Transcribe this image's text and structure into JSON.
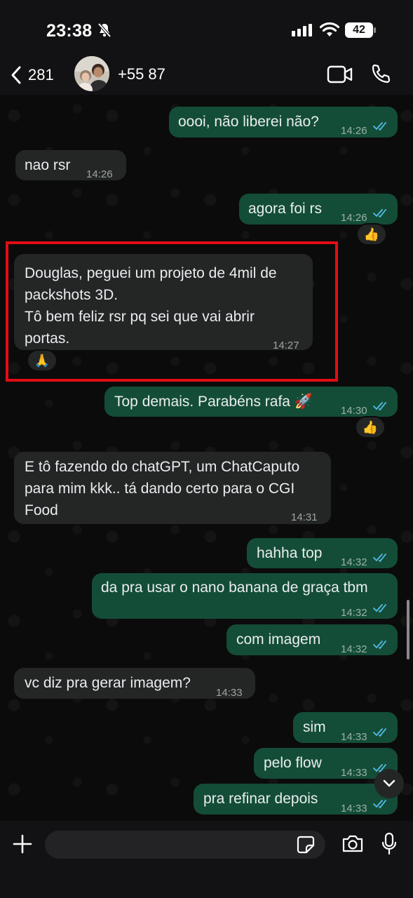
{
  "status_bar": {
    "time": "23:38",
    "battery": "42",
    "icons": [
      "bell-slash-icon",
      "signal-icon",
      "wifi-icon",
      "battery-icon"
    ]
  },
  "header": {
    "back_count": "281",
    "contact": "+55 87",
    "icons": [
      "chevron-left-icon",
      "video-call-icon",
      "phone-icon"
    ]
  },
  "messages": [
    {
      "dir": "out",
      "text": "oooi, não liberei não?",
      "time": "14:26",
      "read": true
    },
    {
      "dir": "in",
      "text": "nao rsr",
      "time": "14:26"
    },
    {
      "dir": "out",
      "text": "agora foi rs",
      "time": "14:26",
      "read": true,
      "reaction": "👍"
    },
    {
      "dir": "in",
      "text": "Douglas, peguei um projeto de 4mil de\npackshots 3D.\nTô bem feliz rsr pq sei que vai abrir\nportas.",
      "time": "14:27",
      "reaction": "🙏",
      "highlighted": true
    },
    {
      "dir": "out",
      "text": "Top demais. Parabéns rafa 🚀",
      "time": "14:30",
      "read": true,
      "reaction": "👍"
    },
    {
      "dir": "in",
      "text": "E tô fazendo do chatGPT, um ChatCaputo\npara mim kkk.. tá dando certo para o CGI\nFood",
      "time": "14:31"
    },
    {
      "dir": "out",
      "text": "hahha top",
      "time": "14:32",
      "read": true
    },
    {
      "dir": "out",
      "text": "da pra usar o nano banana de graça tbm",
      "time": "14:32",
      "read": true
    },
    {
      "dir": "out",
      "text": "com imagem",
      "time": "14:32",
      "read": true
    },
    {
      "dir": "in",
      "text": "vc diz pra gerar imagem?",
      "time": "14:33"
    },
    {
      "dir": "out",
      "text": "sim",
      "time": "14:33",
      "read": true
    },
    {
      "dir": "out",
      "text": "pelo flow",
      "time": "14:33",
      "read": true
    },
    {
      "dir": "out",
      "text": "pra refinar depois",
      "time": "14:33",
      "read": true
    }
  ],
  "input": {
    "placeholder": "",
    "icons": [
      "plus-icon",
      "sticker-icon",
      "camera-icon",
      "microphone-icon"
    ]
  },
  "colors": {
    "outgoing_bubble": "#144d37",
    "incoming_bubble": "#242626",
    "read_ticks": "#53bdeb",
    "highlight_border": "#e20d14"
  }
}
